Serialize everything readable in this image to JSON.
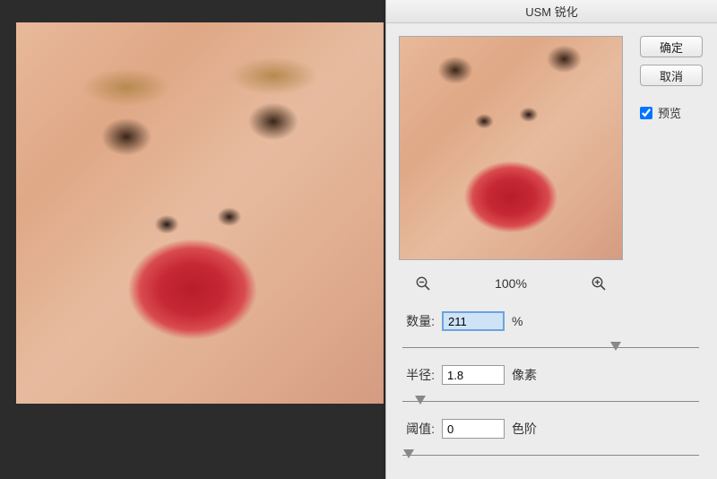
{
  "dialog": {
    "title": "USM 锐化",
    "buttons": {
      "ok": "确定",
      "cancel": "取消"
    },
    "preview_checkbox": {
      "label": "预览",
      "checked": true
    },
    "zoom": {
      "level": "100%"
    },
    "params": {
      "amount": {
        "label": "数量:",
        "value": "211",
        "unit": "%",
        "slider_pct": 72
      },
      "radius": {
        "label": "半径:",
        "value": "1.8",
        "unit": "像素",
        "slider_pct": 6
      },
      "threshold": {
        "label": "阈值:",
        "value": "0",
        "unit": "色阶",
        "slider_pct": 2
      }
    }
  }
}
